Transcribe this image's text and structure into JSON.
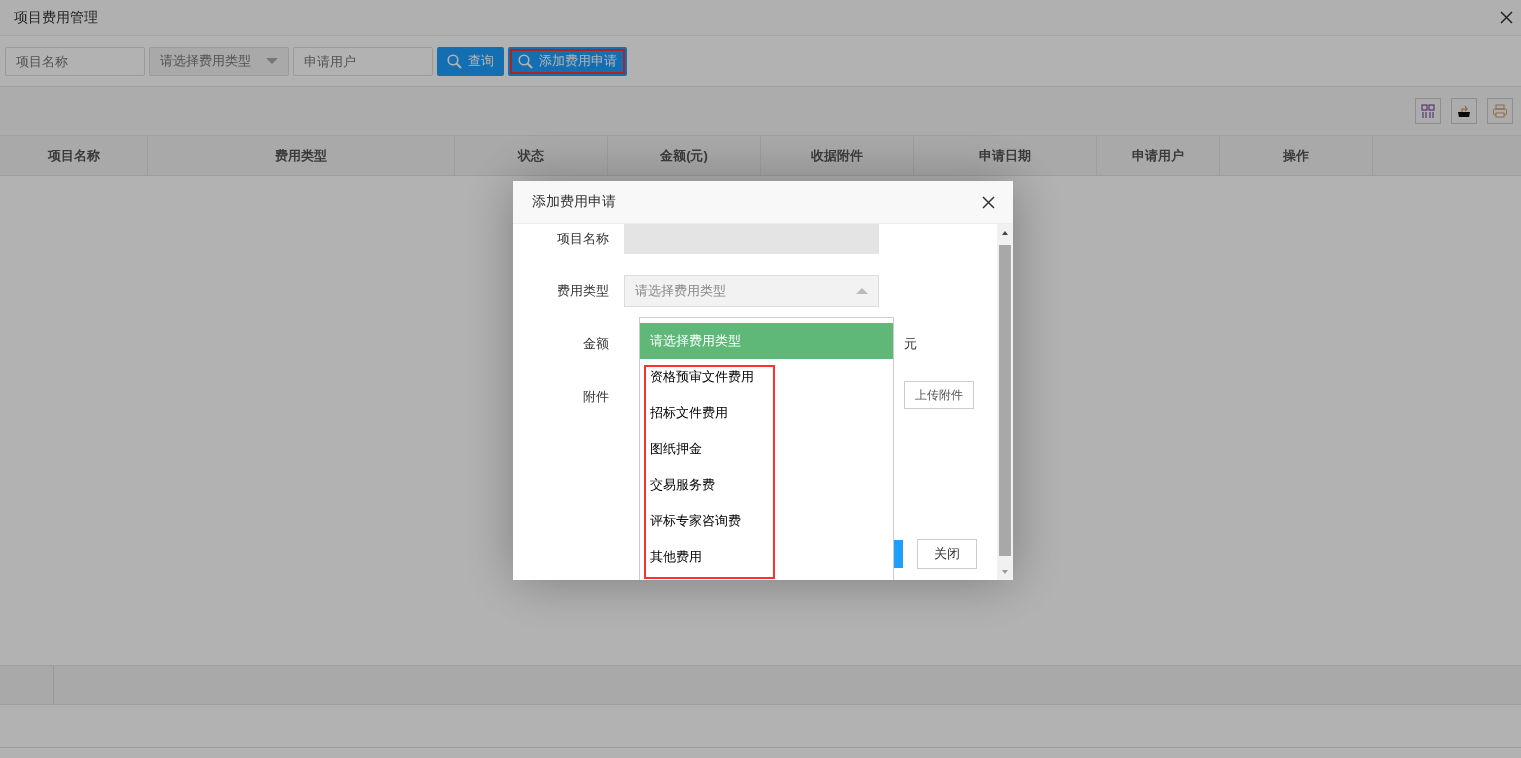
{
  "window": {
    "title": "项目费用管理"
  },
  "filters": [
    {
      "kind": "input",
      "placeholder": "项目名称"
    },
    {
      "kind": "select",
      "placeholder": "请选择费用类型"
    },
    {
      "kind": "input",
      "placeholder": "申请用户"
    }
  ],
  "buttons": [
    {
      "label": "查询",
      "highlighted": false
    },
    {
      "label": "添加费用申请",
      "highlighted": true
    }
  ],
  "table": {
    "columns": [
      "项目名称",
      "费用类型",
      "状态",
      "金额(元)",
      "收据附件",
      "申请日期",
      "申请用户",
      "操作"
    ]
  },
  "dialog": {
    "title": "添加费用申请",
    "fields": [
      {
        "kind": "text",
        "label": "项目名称",
        "disabled": true
      },
      {
        "kind": "select",
        "label": "费用类型",
        "placeholder": "请选择费用类型",
        "expanded": true
      },
      {
        "kind": "amount",
        "label": "金额",
        "unit": "元"
      },
      {
        "kind": "upload",
        "label": "附件",
        "button": "上传附件"
      }
    ],
    "dropdown": {
      "highlighted": true,
      "options": [
        {
          "label": "请选择费用类型",
          "selected": true
        },
        {
          "label": "资格预审文件费用",
          "selected": false
        },
        {
          "label": "招标文件费用",
          "selected": false
        },
        {
          "label": "图纸押金",
          "selected": false
        },
        {
          "label": "交易服务费",
          "selected": false
        },
        {
          "label": "评标专家咨询费",
          "selected": false
        },
        {
          "label": "其他费用",
          "selected": false
        }
      ]
    },
    "buttons": [
      {
        "kind": "primary"
      },
      {
        "kind": "default",
        "label": "关闭"
      }
    ]
  }
}
